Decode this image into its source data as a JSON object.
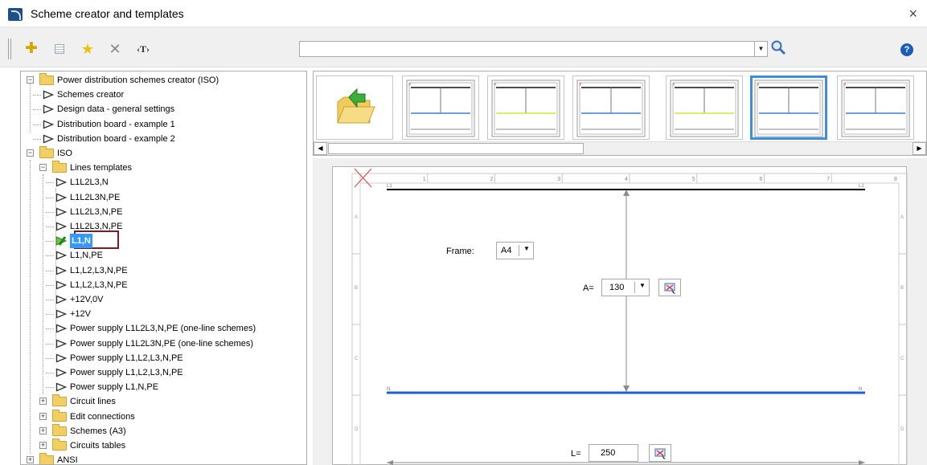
{
  "window": {
    "title": "Scheme creator and templates",
    "close_label": "×"
  },
  "toolbar": {
    "add_icon": "plus-icon",
    "properties_icon": "properties-icon",
    "favorite_icon": "star-icon",
    "delete_icon": "delete-icon",
    "text_label": "‹T›",
    "search": {
      "value": "",
      "placeholder": ""
    },
    "help_label": "?"
  },
  "tree": {
    "items": [
      {
        "label": "Power distribution schemes creator (ISO)",
        "kind": "folder",
        "expanded": true
      },
      {
        "label": "Schemes creator",
        "kind": "template"
      },
      {
        "label": "Design data - general settings",
        "kind": "template"
      },
      {
        "label": "Distribution board - example 1",
        "kind": "template"
      },
      {
        "label": "Distribution board - example 2",
        "kind": "template"
      },
      {
        "label": "ISO",
        "kind": "folder",
        "expanded": true
      },
      {
        "label": "Lines templates",
        "kind": "folder",
        "expanded": true
      },
      {
        "label": "L1L2L3,N",
        "kind": "template"
      },
      {
        "label": "L1L2L3N,PE",
        "kind": "template"
      },
      {
        "label": "L1L2L3,N,PE",
        "kind": "template"
      },
      {
        "label": "L1L2L3,N,PE",
        "kind": "template"
      },
      {
        "label": "L1,N",
        "kind": "template",
        "selected": true
      },
      {
        "label": "L1,N,PE",
        "kind": "template"
      },
      {
        "label": "L1,L2,L3,N,PE",
        "kind": "template"
      },
      {
        "label": "L1,L2,L3,N,PE",
        "kind": "template"
      },
      {
        "label": "+12V,0V",
        "kind": "template"
      },
      {
        "label": "+12V",
        "kind": "template"
      },
      {
        "label": "Power supply L1L2L3,N,PE (one-line schemes)",
        "kind": "template"
      },
      {
        "label": "Power supply L1L2L3N,PE (one-line schemes)",
        "kind": "template"
      },
      {
        "label": "Power supply L1,L2,L3,N,PE",
        "kind": "template"
      },
      {
        "label": "Power supply L1,L2,L3,N,PE",
        "kind": "template"
      },
      {
        "label": "Power supply L1,N,PE",
        "kind": "template"
      },
      {
        "label": "Circuit lines",
        "kind": "folder",
        "expanded": false
      },
      {
        "label": "Edit connections",
        "kind": "folder",
        "expanded": false
      },
      {
        "label": "Schemes (A3)",
        "kind": "folder",
        "expanded": false
      },
      {
        "label": "Circuits tables",
        "kind": "folder",
        "expanded": false
      },
      {
        "label": "ANSI",
        "kind": "folder",
        "expanded": false
      }
    ]
  },
  "thumbnails": {
    "items": [
      {
        "name": "open-folder",
        "selected": false
      },
      {
        "name": "lines-template-1",
        "line_color": "#3a7fd9",
        "selected": false
      },
      {
        "name": "lines-template-2",
        "line_color": "#d8e23a",
        "selected": false
      },
      {
        "name": "lines-template-3",
        "line_color": "#3a7fd9",
        "selected": false
      },
      {
        "name": "lines-template-4",
        "line_color": "#d8e23a",
        "selected": false
      },
      {
        "name": "lines-template-5",
        "line_color": "#3a7fd9",
        "selected": true
      },
      {
        "name": "lines-template-6",
        "line_color": "#3a7fd9",
        "selected": false
      }
    ]
  },
  "preview": {
    "column_numbers": [
      "1",
      "2",
      "3",
      "4",
      "5",
      "6",
      "7",
      "8"
    ],
    "row_letters": [
      "A",
      "B",
      "C",
      "D"
    ],
    "top_line_label_left": "L1",
    "top_line_label_right": "L1",
    "bottom_line_label_left": "N",
    "bottom_line_label_right": "N",
    "frame_label": "Frame:",
    "frame_value": "A4",
    "a_label": "A=",
    "a_value": "130",
    "l_label": "L=",
    "l_value": "250",
    "colors": {
      "top_line": "#000000",
      "bottom_line": "#1f5fd6",
      "dim_line": "#8c8c8c",
      "cross": "#e04040"
    }
  }
}
